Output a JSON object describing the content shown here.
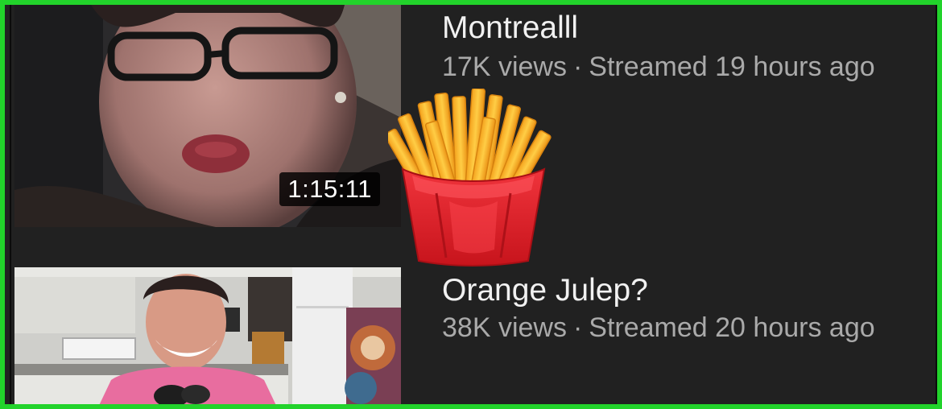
{
  "videos": [
    {
      "title": "Montrealll",
      "views": "17K views",
      "separator": "·",
      "streamed": "Streamed 19 hours ago",
      "duration": "1:15:11"
    },
    {
      "title": "Orange Julep?",
      "views": "38K views",
      "separator": "·",
      "streamed": "Streamed 20 hours ago"
    }
  ],
  "overlay": {
    "emoji": "french-fries"
  },
  "colors": {
    "background": "#212121",
    "frame": "#22d32b",
    "title": "#f1f1f1",
    "meta": "#aaaaaa"
  }
}
